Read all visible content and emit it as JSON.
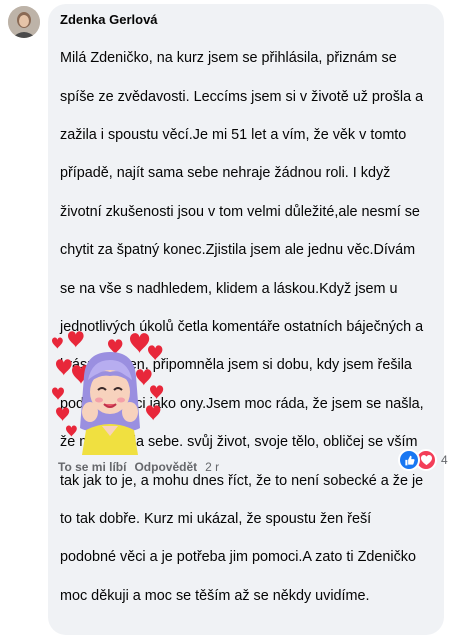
{
  "comment": {
    "author": "Zdenka Gerlová",
    "lines": [
      "Milá Zdeničko, na kurz jsem se přihlásila, přiznám se",
      "spíše ze zvědavosti. Leccíms jsem si v životě už prošla a",
      "zažila i spoustu věcí.Je mi 51 let a vím, že věk v tomto",
      "případě, najít sama sebe nehraje žádnou roli. I když",
      "životní zkušenosti jsou v tom velmi důležité,ale nesmí se",
      "chytit za špatný konec.Zjistila jsem ale jednu věc.Dívám",
      "se na vše s nadhledem, klidem a láskou.Když jsem u",
      "jednotlivých úkolů četla komentáře ostatních báječných a",
      "krásných žen, připomněla jsem si dobu, kdy jsem řešila",
      "podobné věci jako ony.Jsem moc ráda, že jsem se našla,",
      "že mám ráda sebe. svůj život, svoje tělo, obličej se vším",
      "tak jak to je, a mohu dnes říct, že to není sobecké a že je",
      "to tak dobře. Kurz mi ukázal, že spoustu žen řeší",
      "podobné věci a je potřeba jim pomoci.A zato ti Zdeničko",
      "moc děkuji a moc se těším až se někdy uvidíme."
    ]
  },
  "actions": {
    "like": "To se mi líbí",
    "reply": "Odpovědět",
    "time": "2 r"
  },
  "reactions": {
    "count": "4",
    "types": [
      "like-icon",
      "love-icon"
    ],
    "colors": {
      "like": "#1877f2",
      "love": "#f33e58"
    }
  },
  "sticker": {
    "name": "avatar-hearts-sticker"
  }
}
